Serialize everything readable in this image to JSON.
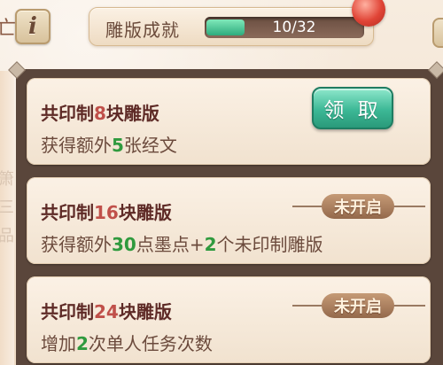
{
  "header": {
    "partial_glyph": "亡",
    "info_icon_glyph": "i",
    "progress": {
      "label": "雕版成就",
      "current": 10,
      "total": 32,
      "text": "10/32",
      "fraction": 0.3125
    }
  },
  "side_strip_chars": [
    "箫",
    "三",
    "品"
  ],
  "achievements": [
    {
      "title_prefix": "共印制",
      "count": "8",
      "title_suffix": "块雕版",
      "reward_prefix": "获得额外",
      "reward_num1": "5",
      "reward_mid": "张经文",
      "reward_num2": "",
      "reward_suffix": "",
      "state": "claimable",
      "action_label": "领 取"
    },
    {
      "title_prefix": "共印制",
      "count": "16",
      "title_suffix": "块雕版",
      "reward_prefix": "获得额外",
      "reward_num1": "30",
      "reward_mid": "点墨点+",
      "reward_num2": "2",
      "reward_suffix": "个未印制雕版",
      "state": "locked",
      "action_label": "未开启"
    },
    {
      "title_prefix": "共印制",
      "count": "24",
      "title_suffix": "块雕版",
      "reward_prefix": "增加",
      "reward_num1": "2",
      "reward_mid": "次单人任务次数",
      "reward_num2": "",
      "reward_suffix": "",
      "state": "locked",
      "action_label": "未开启"
    }
  ],
  "colors": {
    "title_text": "#5e2a26",
    "count_highlight": "#c0504a",
    "reward_highlight": "#2f9a3e",
    "claim_button": "#3cb896",
    "progress_fill": "#2eab7d",
    "locked_badge": "#94694b"
  }
}
